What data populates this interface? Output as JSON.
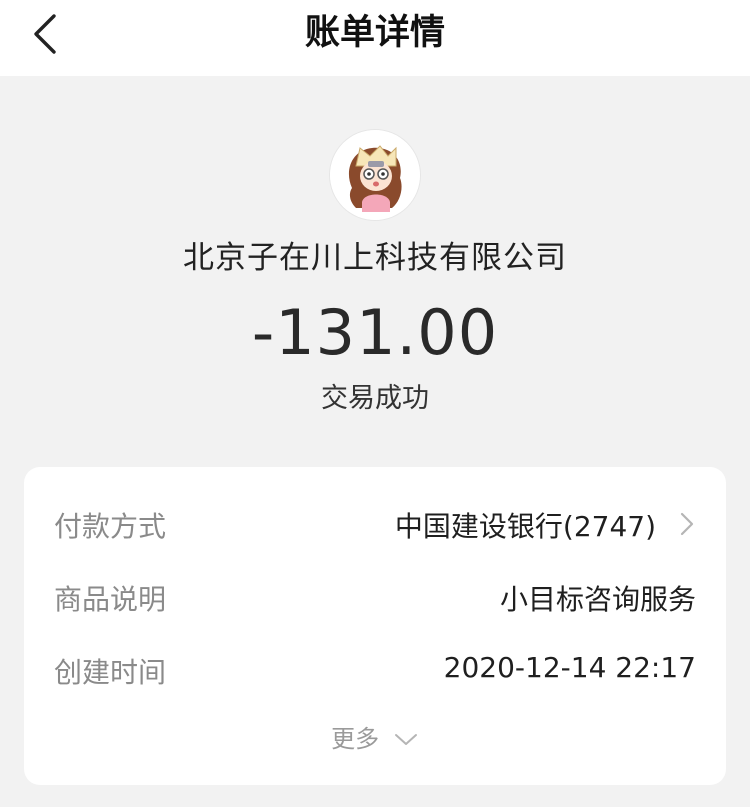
{
  "header": {
    "title": "账单详情",
    "back_icon": "chevron-left-icon"
  },
  "merchant": {
    "name": "北京子在川上科技有限公司",
    "avatar_icon": "cartoon-girl-avatar"
  },
  "transaction": {
    "amount": "-131.00",
    "status": "交易成功"
  },
  "details": {
    "payment_method": {
      "label": "付款方式",
      "value": "中国建设银行(2747)"
    },
    "product_description": {
      "label": "商品说明",
      "value": "小目标咨询服务"
    },
    "created_time": {
      "label": "创建时间",
      "value": "2020-12-14 22:17"
    },
    "more_label": "更多"
  },
  "colors": {
    "background": "#f2f2f2",
    "card": "#ffffff",
    "label_gray": "#8a8a8a",
    "text_dark": "#222222"
  }
}
